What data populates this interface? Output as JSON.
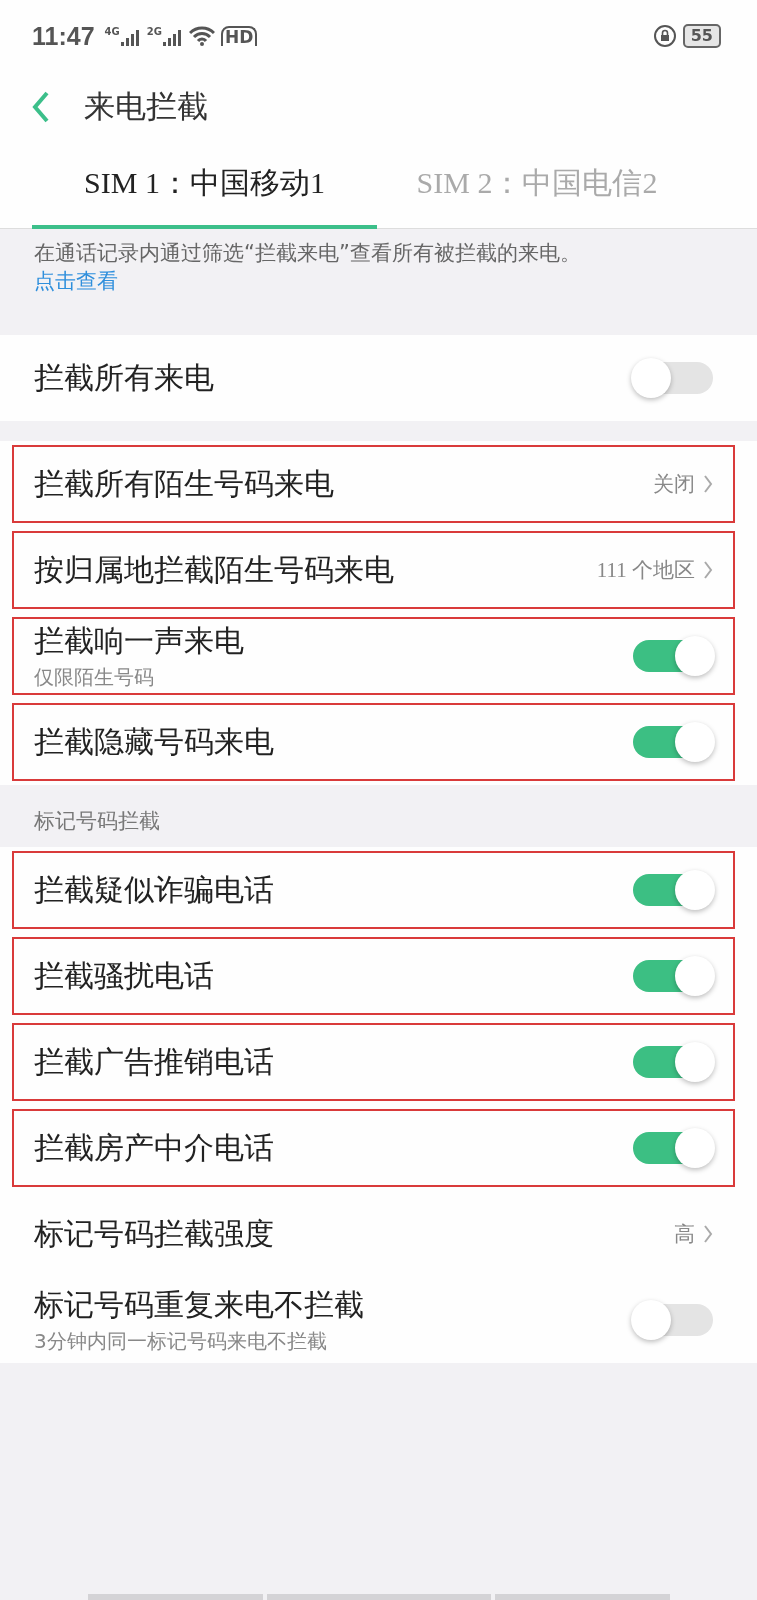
{
  "status_bar": {
    "time": "11:47",
    "sim_1_network": "4G",
    "sim_2_network": "2G",
    "hd_label": "HD",
    "battery": "55"
  },
  "header": {
    "title": "来电拦截"
  },
  "tabs": [
    {
      "label": "SIM 1：中国移动1",
      "selected": true
    },
    {
      "label": "SIM 2：中国电信2",
      "selected": false
    }
  ],
  "info": {
    "text": "在通话记录内通过筛选“拦截来电”查看所有被拦截的来电。",
    "link": "点击查看"
  },
  "groups": [
    {
      "rows": [
        {
          "kind": "switch",
          "label": "拦截所有来电",
          "on": false,
          "highlighted": false
        }
      ]
    },
    {
      "rows": [
        {
          "kind": "link",
          "label": "拦截所有陌生号码来电",
          "value": "关闭",
          "highlighted": true
        },
        {
          "kind": "link",
          "label": "按归属地拦截陌生号码来电",
          "value": "111 个地区",
          "highlighted": true
        },
        {
          "kind": "switch",
          "label": "拦截响一声来电",
          "subtitle": "仅限陌生号码",
          "on": true,
          "highlighted": true
        },
        {
          "kind": "switch",
          "label": "拦截隐藏号码来电",
          "on": true,
          "highlighted": true
        }
      ]
    },
    {
      "title": "标记号码拦截",
      "rows": [
        {
          "kind": "switch",
          "label": "拦截疑似诈骗电话",
          "on": true,
          "highlighted": true
        },
        {
          "kind": "switch",
          "label": "拦截骚扰电话",
          "on": true,
          "highlighted": true
        },
        {
          "kind": "switch",
          "label": "拦截广告推销电话",
          "on": true,
          "highlighted": true
        },
        {
          "kind": "switch",
          "label": "拦截房产中介电话",
          "on": true,
          "highlighted": true
        },
        {
          "kind": "link",
          "label": "标记号码拦截强度",
          "value": "高",
          "highlighted": false
        },
        {
          "kind": "switch",
          "label": "标记号码重复来电不拦截",
          "subtitle": "3分钟内同一标记号码来电不拦截",
          "on": false,
          "highlighted": false
        }
      ]
    }
  ]
}
